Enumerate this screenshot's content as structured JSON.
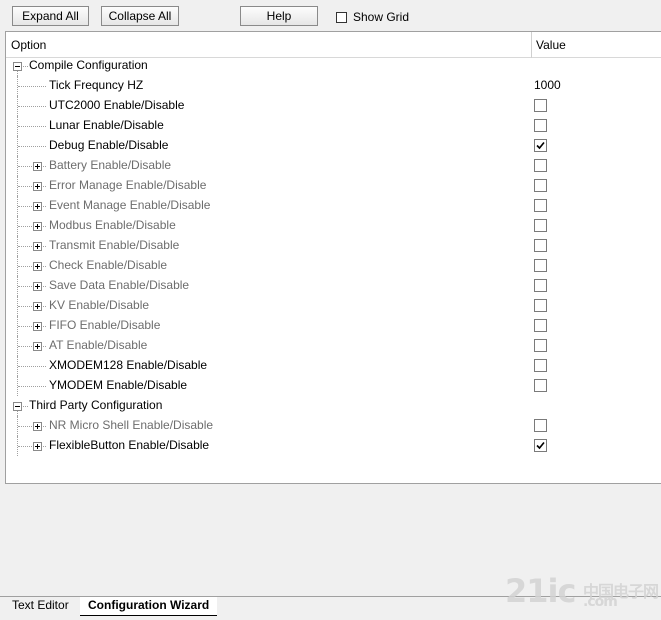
{
  "toolbar": {
    "expand_all": "Expand All",
    "collapse_all": "Collapse All",
    "help": "Help",
    "show_grid": "Show Grid"
  },
  "grid": {
    "header_option": "Option",
    "header_value": "Value"
  },
  "rows": [
    {
      "label": "Compile Configuration",
      "level": 0,
      "expander": "minus",
      "dim": false
    },
    {
      "label": "Tick Frequncy HZ",
      "level": 1,
      "expander": "none",
      "dim": false,
      "value": "1000"
    },
    {
      "label": "UTC2000 Enable/Disable",
      "level": 1,
      "expander": "none",
      "dim": false,
      "checked": false
    },
    {
      "label": "Lunar Enable/Disable",
      "level": 1,
      "expander": "none",
      "dim": false,
      "checked": false
    },
    {
      "label": "Debug Enable/Disable",
      "level": 1,
      "expander": "none",
      "dim": false,
      "checked": true
    },
    {
      "label": "Battery Enable/Disable",
      "level": 1,
      "expander": "plus",
      "dim": true,
      "checked": false
    },
    {
      "label": "Error Manage Enable/Disable",
      "level": 1,
      "expander": "plus",
      "dim": true,
      "checked": false
    },
    {
      "label": "Event Manage Enable/Disable",
      "level": 1,
      "expander": "plus",
      "dim": true,
      "checked": false
    },
    {
      "label": "Modbus Enable/Disable",
      "level": 1,
      "expander": "plus",
      "dim": true,
      "checked": false
    },
    {
      "label": "Transmit Enable/Disable",
      "level": 1,
      "expander": "plus",
      "dim": true,
      "checked": false
    },
    {
      "label": "Check Enable/Disable",
      "level": 1,
      "expander": "plus",
      "dim": true,
      "checked": false
    },
    {
      "label": "Save Data Enable/Disable",
      "level": 1,
      "expander": "plus",
      "dim": true,
      "checked": false
    },
    {
      "label": "KV Enable/Disable",
      "level": 1,
      "expander": "plus",
      "dim": true,
      "checked": false
    },
    {
      "label": "FIFO Enable/Disable",
      "level": 1,
      "expander": "plus",
      "dim": true,
      "checked": false
    },
    {
      "label": "AT Enable/Disable",
      "level": 1,
      "expander": "plus",
      "dim": true,
      "checked": false
    },
    {
      "label": "XMODEM128 Enable/Disable",
      "level": 1,
      "expander": "none",
      "dim": false,
      "checked": false
    },
    {
      "label": "YMODEM Enable/Disable",
      "level": 1,
      "expander": "none",
      "dim": false,
      "checked": false
    },
    {
      "label": "Third Party Configuration",
      "level": 0,
      "expander": "minus",
      "dim": false
    },
    {
      "label": "NR Micro Shell Enable/Disable",
      "level": 1,
      "expander": "plus",
      "dim": true,
      "checked": false
    },
    {
      "label": "FlexibleButton Enable/Disable",
      "level": 1,
      "expander": "plus",
      "dim": false,
      "checked": true
    }
  ],
  "tabs": [
    {
      "label": "Text Editor",
      "active": false
    },
    {
      "label": "Configuration Wizard",
      "active": true
    }
  ],
  "watermark": {
    "main": "21ic",
    "cn": "中国电子网",
    "com": ".com"
  }
}
